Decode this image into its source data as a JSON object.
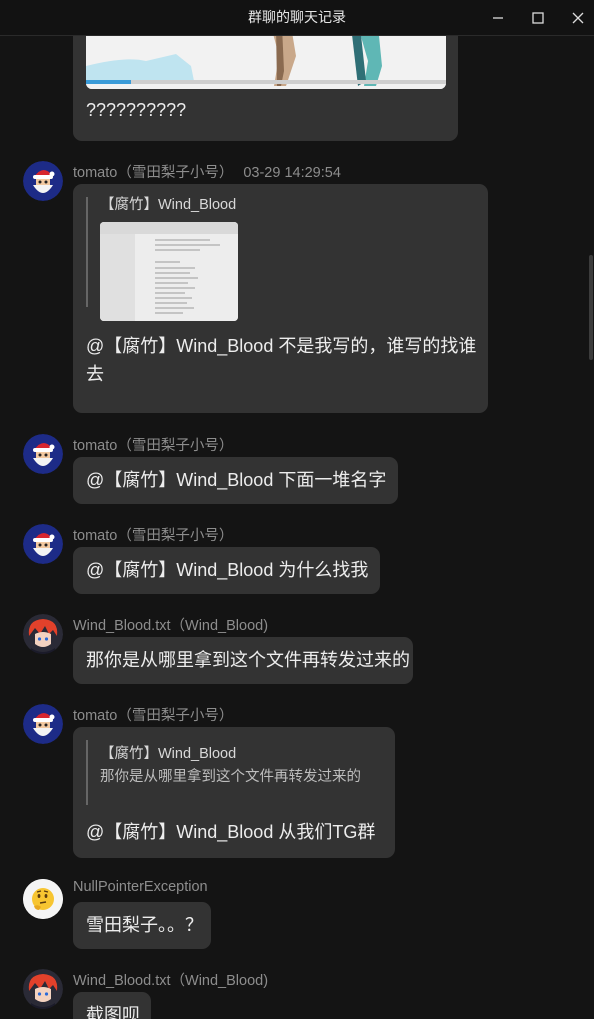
{
  "window": {
    "title": "群聊的聊天记录"
  },
  "messages": [
    {
      "text": "??????????"
    },
    {
      "sender": "tomato（雪田梨子小号）",
      "time": "03-29 14:29:54",
      "quote": {
        "author": "【腐竹】Wind_Blood"
      },
      "text_line1": "@【腐竹】Wind_Blood 不是我写的，谁写的找谁",
      "text_line2": "去"
    },
    {
      "sender": "tomato（雪田梨子小号）",
      "text": "@【腐竹】Wind_Blood 下面一堆名字"
    },
    {
      "sender": "tomato（雪田梨子小号）",
      "text": "@【腐竹】Wind_Blood 为什么找我"
    },
    {
      "sender": "Wind_Blood.txt（Wind_Blood)",
      "text": "那你是从哪里拿到这个文件再转发过来的"
    },
    {
      "sender": "tomato（雪田梨子小号）",
      "quote": {
        "author": "【腐竹】Wind_Blood",
        "text": "那你是从哪里拿到这个文件再转发过来的"
      },
      "text": "@【腐竹】Wind_Blood 从我们TG群"
    },
    {
      "sender": "NullPointerException",
      "text": "雪田梨子。。？"
    },
    {
      "sender": "Wind_Blood.txt（Wind_Blood)",
      "text": "截图呗"
    }
  ],
  "colors": {
    "background": "#141414",
    "bubble": "#333333",
    "name_text": "#8d8d8d",
    "quote_bar": "#666666"
  },
  "icons": [
    "minimize-icon",
    "maximize-icon",
    "close-icon",
    "santa-avatar",
    "anime-avatar",
    "thinking-emoji-avatar"
  ]
}
